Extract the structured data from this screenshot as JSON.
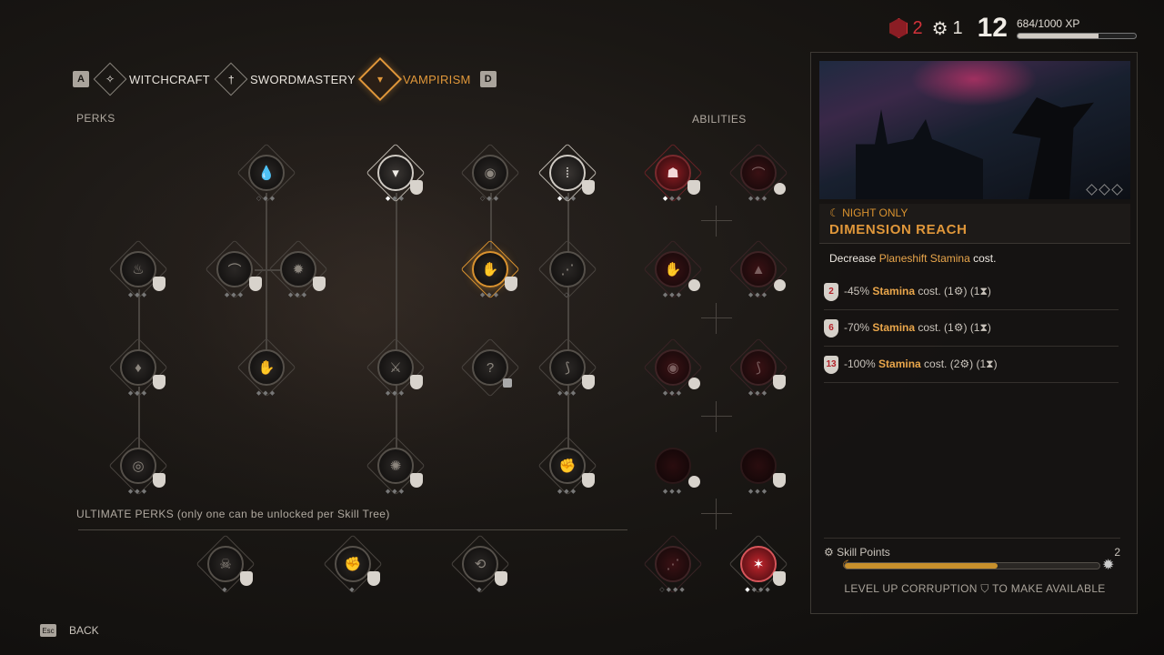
{
  "hud": {
    "blood_points": "2",
    "skill_points": "1",
    "level": "12",
    "xp_text": "684/1000 XP",
    "xp_progress": 0.684
  },
  "tabs": {
    "prev_key": "A",
    "next_key": "D",
    "items": [
      {
        "label": "WITCHCRAFT",
        "icon": "witchcraft-icon"
      },
      {
        "label": "SWORDMASTERY",
        "icon": "sword-icon"
      },
      {
        "label": "VAMPIRISM",
        "icon": "fangs-icon",
        "active": true
      }
    ]
  },
  "labels": {
    "perks": "PERKS",
    "abilities": "ABILITIES",
    "ultimate": "ULTIMATE PERKS (only one can be unlocked per Skill Tree)"
  },
  "colors": {
    "accent": "#e0973a",
    "blood": "#d2323a",
    "text": "#cfc8bf"
  },
  "panel": {
    "tag": "☾ NIGHT ONLY",
    "title": "DIMENSION REACH",
    "desc_pre": "Decrease ",
    "desc_hl": "Planeshift Stamina",
    "desc_post": " cost.",
    "ranks": [
      {
        "req": "2",
        "pre": "-45% ",
        "hl": "Stamina",
        "post": " cost. (1⚙) (1⧗)"
      },
      {
        "req": "6",
        "pre": "-70% ",
        "hl": "Stamina",
        "post": " cost. (1⚙) (1⧗)"
      },
      {
        "req": "13",
        "pre": "-100% ",
        "hl": "Stamina",
        "post": " cost. (2⚙) (1⧗)"
      }
    ],
    "skill_points_label": "Skill Points",
    "skill_points_value": "2",
    "corruption_progress": 0.6,
    "unlock_pre": "LEVEL UP CORRUPTION",
    "unlock_post": "TO MAKE AVAILABLE"
  },
  "footer": {
    "esc_key": "Esc",
    "back_label": "BACK"
  }
}
